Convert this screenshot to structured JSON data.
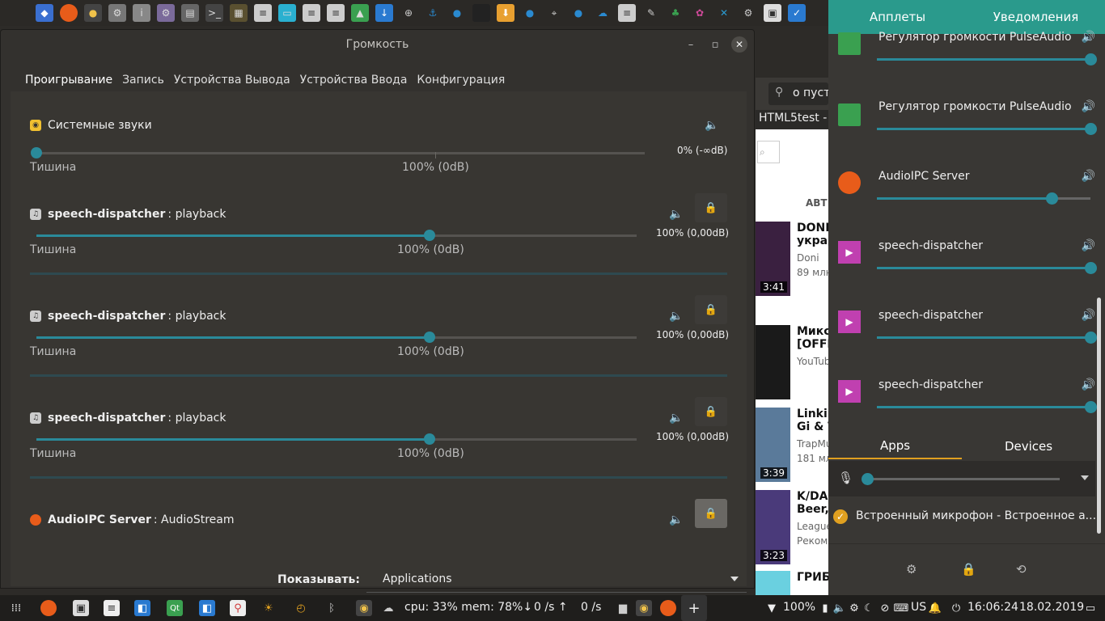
{
  "window": {
    "title": "Громкость"
  },
  "tabs": [
    "Проигрывание",
    "Запись",
    "Устройства Вывода",
    "Устройства Ввода",
    "Конфигурация"
  ],
  "streams": [
    {
      "app": "Системные звуки",
      "detail": "",
      "left_label": "Тишина",
      "mid_label": "100% (0dB)",
      "value_text": "0% (-∞dB)",
      "volume": 0.0,
      "locked": null
    },
    {
      "app": "speech-dispatcher",
      "detail": ": playback",
      "left_label": "Тишина",
      "mid_label": "100% (0dB)",
      "value_text": "100% (0,00dB)",
      "volume": 1.0,
      "locked": false
    },
    {
      "app": "speech-dispatcher",
      "detail": ": playback",
      "left_label": "Тишина",
      "mid_label": "100% (0dB)",
      "value_text": "100% (0,00dB)",
      "volume": 1.0,
      "locked": false
    },
    {
      "app": "speech-dispatcher",
      "detail": ": playback",
      "left_label": "Тишина",
      "mid_label": "100% (0dB)",
      "value_text": "100% (0,00dB)",
      "volume": 1.0,
      "locked": false
    },
    {
      "app": "AudioIPC Server",
      "detail": ": AudioStream",
      "locked": true
    }
  ],
  "show": {
    "label": "Показывать:",
    "value": "Applications"
  },
  "panel": {
    "tabs": [
      "Апплеты",
      "Уведомления"
    ],
    "apps": [
      {
        "name": "Регулятор громкости PulseAudio",
        "volume": 1.0,
        "icon": "pulseaudio-icon"
      },
      {
        "name": "Регулятор громкости PulseAudio",
        "volume": 1.0,
        "icon": "pulseaudio-icon"
      },
      {
        "name": "AudioIPC Server",
        "volume": 0.82,
        "icon": "firefox-icon"
      },
      {
        "name": "speech-dispatcher",
        "volume": 1.0,
        "icon": "play-icon"
      },
      {
        "name": "speech-dispatcher",
        "volume": 1.0,
        "icon": "play-icon"
      },
      {
        "name": "speech-dispatcher",
        "volume": 1.0,
        "icon": "play-icon"
      }
    ],
    "subtabs": [
      "Apps",
      "Devices"
    ],
    "mic_volume": 0.0,
    "device": "Встроенный микрофон - Встроенное а..."
  },
  "browser": {
    "search_partial": "о пуст",
    "tab_title": "HTML5test -",
    "section": "АВТ",
    "videos": [
      {
        "title1": "DONI f",
        "title2": "украд",
        "sub1": "Doni",
        "sub2": "89 млн",
        "duration": "3:41"
      },
      {
        "title1": "Микс",
        "title2": "[OFFIC",
        "sub1": "YouTub",
        "sub2": "",
        "duration": ""
      },
      {
        "title1": "Linkin",
        "title2": "Gi & Tc",
        "sub1": "TrapMu",
        "sub2": "181 мл",
        "duration": "3:39"
      },
      {
        "title1": "K/DA -",
        "title2": "Beer, (",
        "sub1": "League",
        "sub2": "Реком",
        "duration": "3:23"
      },
      {
        "title1": "ГРИБЫ",
        "title2": "",
        "sub1": "",
        "sub2": "",
        "duration": ""
      }
    ]
  },
  "taskbar": {
    "sysmon": "cpu: 33% mem: 78%↓",
    "net_up": "0 /s ↑",
    "net_down": "0 /s",
    "battery": "100%",
    "layout": "US",
    "time": "16:06:24",
    "date": "18.02.2019"
  },
  "colors": {
    "accent": "#2a8a9a",
    "tab_underline": "#e0a020",
    "panel_header": "#2a9a8c"
  }
}
